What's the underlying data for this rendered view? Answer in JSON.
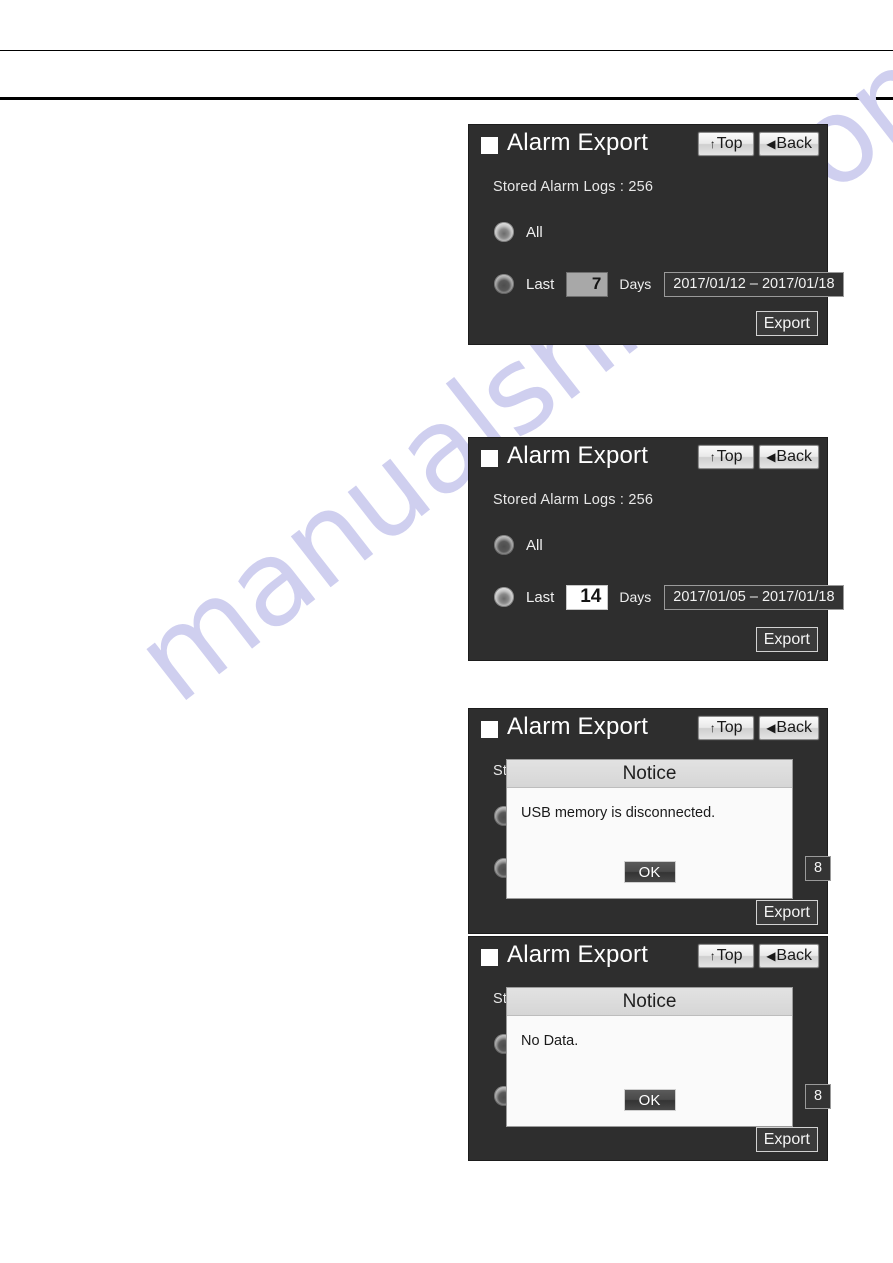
{
  "watermark": {
    "text": "manualshive.com",
    "color": "#cfcfef"
  },
  "panel_defaults": {
    "title": "Alarm Export",
    "title_icon": "filled-square-icon",
    "top_button": {
      "label": "Top",
      "glyph": "↑"
    },
    "back_button": {
      "label": "Back",
      "glyph": "◀"
    },
    "stored_logs": "Stored Alarm Logs : 256",
    "option_all": "All",
    "option_last": "Last",
    "days_unit": "Days",
    "export_label": "Export"
  },
  "panels": [
    {
      "id": "panel-7-days",
      "title": "Alarm Export",
      "stored_logs": "Stored Alarm Logs : 256",
      "option_all": "All",
      "option_last": "Last",
      "days_value": "7",
      "days_unit": "Days",
      "date_range": "2017/01/12 – 2017/01/18",
      "export_label": "Export",
      "selected": "all",
      "days_field_state": "inactive"
    },
    {
      "id": "panel-14-days",
      "title": "Alarm Export",
      "stored_logs": "Stored Alarm Logs : 256",
      "option_all": "All",
      "option_last": "Last",
      "days_value": "14",
      "days_unit": "Days",
      "date_range": "2017/01/05 – 2017/01/18",
      "export_label": "Export",
      "selected": "last",
      "days_field_state": "active"
    },
    {
      "id": "panel-usb-notice",
      "title": "Alarm Export",
      "stored_logs_partial": "St",
      "date_partial": "8",
      "export_label": "Export",
      "dialog": {
        "title": "Notice",
        "message": "USB memory is disconnected.",
        "ok_label": "OK"
      }
    },
    {
      "id": "panel-nodata-notice",
      "title": "Alarm Export",
      "stored_logs_partial": "St",
      "date_partial": "8",
      "export_label": "Export",
      "dialog": {
        "title": "Notice",
        "message": "No Data.",
        "ok_label": "OK"
      }
    }
  ]
}
